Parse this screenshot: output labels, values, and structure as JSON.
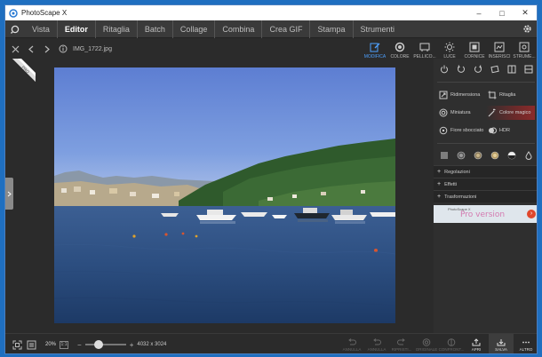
{
  "window": {
    "title": "PhotoScape X",
    "minimize": "–",
    "maximize": "□",
    "close": "✕"
  },
  "menu": {
    "items": [
      "Vista",
      "Editor",
      "Ritaglia",
      "Batch",
      "Collage",
      "Combina",
      "Crea GIF",
      "Stampa",
      "Strumenti"
    ],
    "active": "Editor"
  },
  "file": {
    "name": "IMG_1722.jpg"
  },
  "ribbon_label": "PRO",
  "tabs": [
    {
      "label": "MODIFICA",
      "icon": "edit-icon",
      "active": true
    },
    {
      "label": "COLORE",
      "icon": "color-icon",
      "active": false
    },
    {
      "label": "PELLICO...",
      "icon": "film-icon",
      "active": false
    },
    {
      "label": "LUCE",
      "icon": "light-icon",
      "active": false
    },
    {
      "label": "CORNICE",
      "icon": "frame-icon",
      "active": false
    },
    {
      "label": "INSERISCI",
      "icon": "insert-icon",
      "active": false
    },
    {
      "label": "STRUME...",
      "icon": "tools-icon",
      "active": false
    }
  ],
  "panel": {
    "features": [
      {
        "label": "Ridimensiona",
        "icon": "resize-icon"
      },
      {
        "label": "Ritaglia",
        "icon": "crop-icon"
      },
      {
        "label": "Miniatura",
        "icon": "miniature-icon"
      },
      {
        "label": "Colore magico",
        "icon": "magic-color-icon"
      },
      {
        "label": "Fiore sbocciato",
        "icon": "bloom-icon"
      },
      {
        "label": "HDR",
        "icon": "hdr-icon"
      }
    ],
    "sections": [
      "Regolazioni",
      "Effetti",
      "Trasformazioni"
    ],
    "pro_small": "PhotoScape X",
    "pro_big": "Pro version",
    "pro_go": "›"
  },
  "bottom": {
    "zoom": "20%",
    "zoom_box": "1:1",
    "dims": "4032 x 3024",
    "slider_value": 0.3,
    "actions": [
      {
        "label": "ANNULLA",
        "icon": "undo-icon",
        "enabled": false
      },
      {
        "label": "ANNULLA",
        "icon": "undo-all-icon",
        "enabled": false
      },
      {
        "label": "RIPRISTI...",
        "icon": "redo-icon",
        "enabled": false
      },
      {
        "label": "ORIGINALE",
        "icon": "original-icon",
        "enabled": false
      },
      {
        "label": "CONFRONT...",
        "icon": "compare-icon",
        "enabled": false
      },
      {
        "label": "APRI",
        "icon": "open-icon",
        "enabled": true
      },
      {
        "label": "SALVA",
        "icon": "save-icon",
        "enabled": true
      },
      {
        "label": "ALTRO",
        "icon": "more-icon",
        "enabled": true
      }
    ]
  },
  "colors": {
    "accent": "#4ea1ff",
    "background": "#2b2b2b",
    "panel": "#2f2f2f"
  }
}
